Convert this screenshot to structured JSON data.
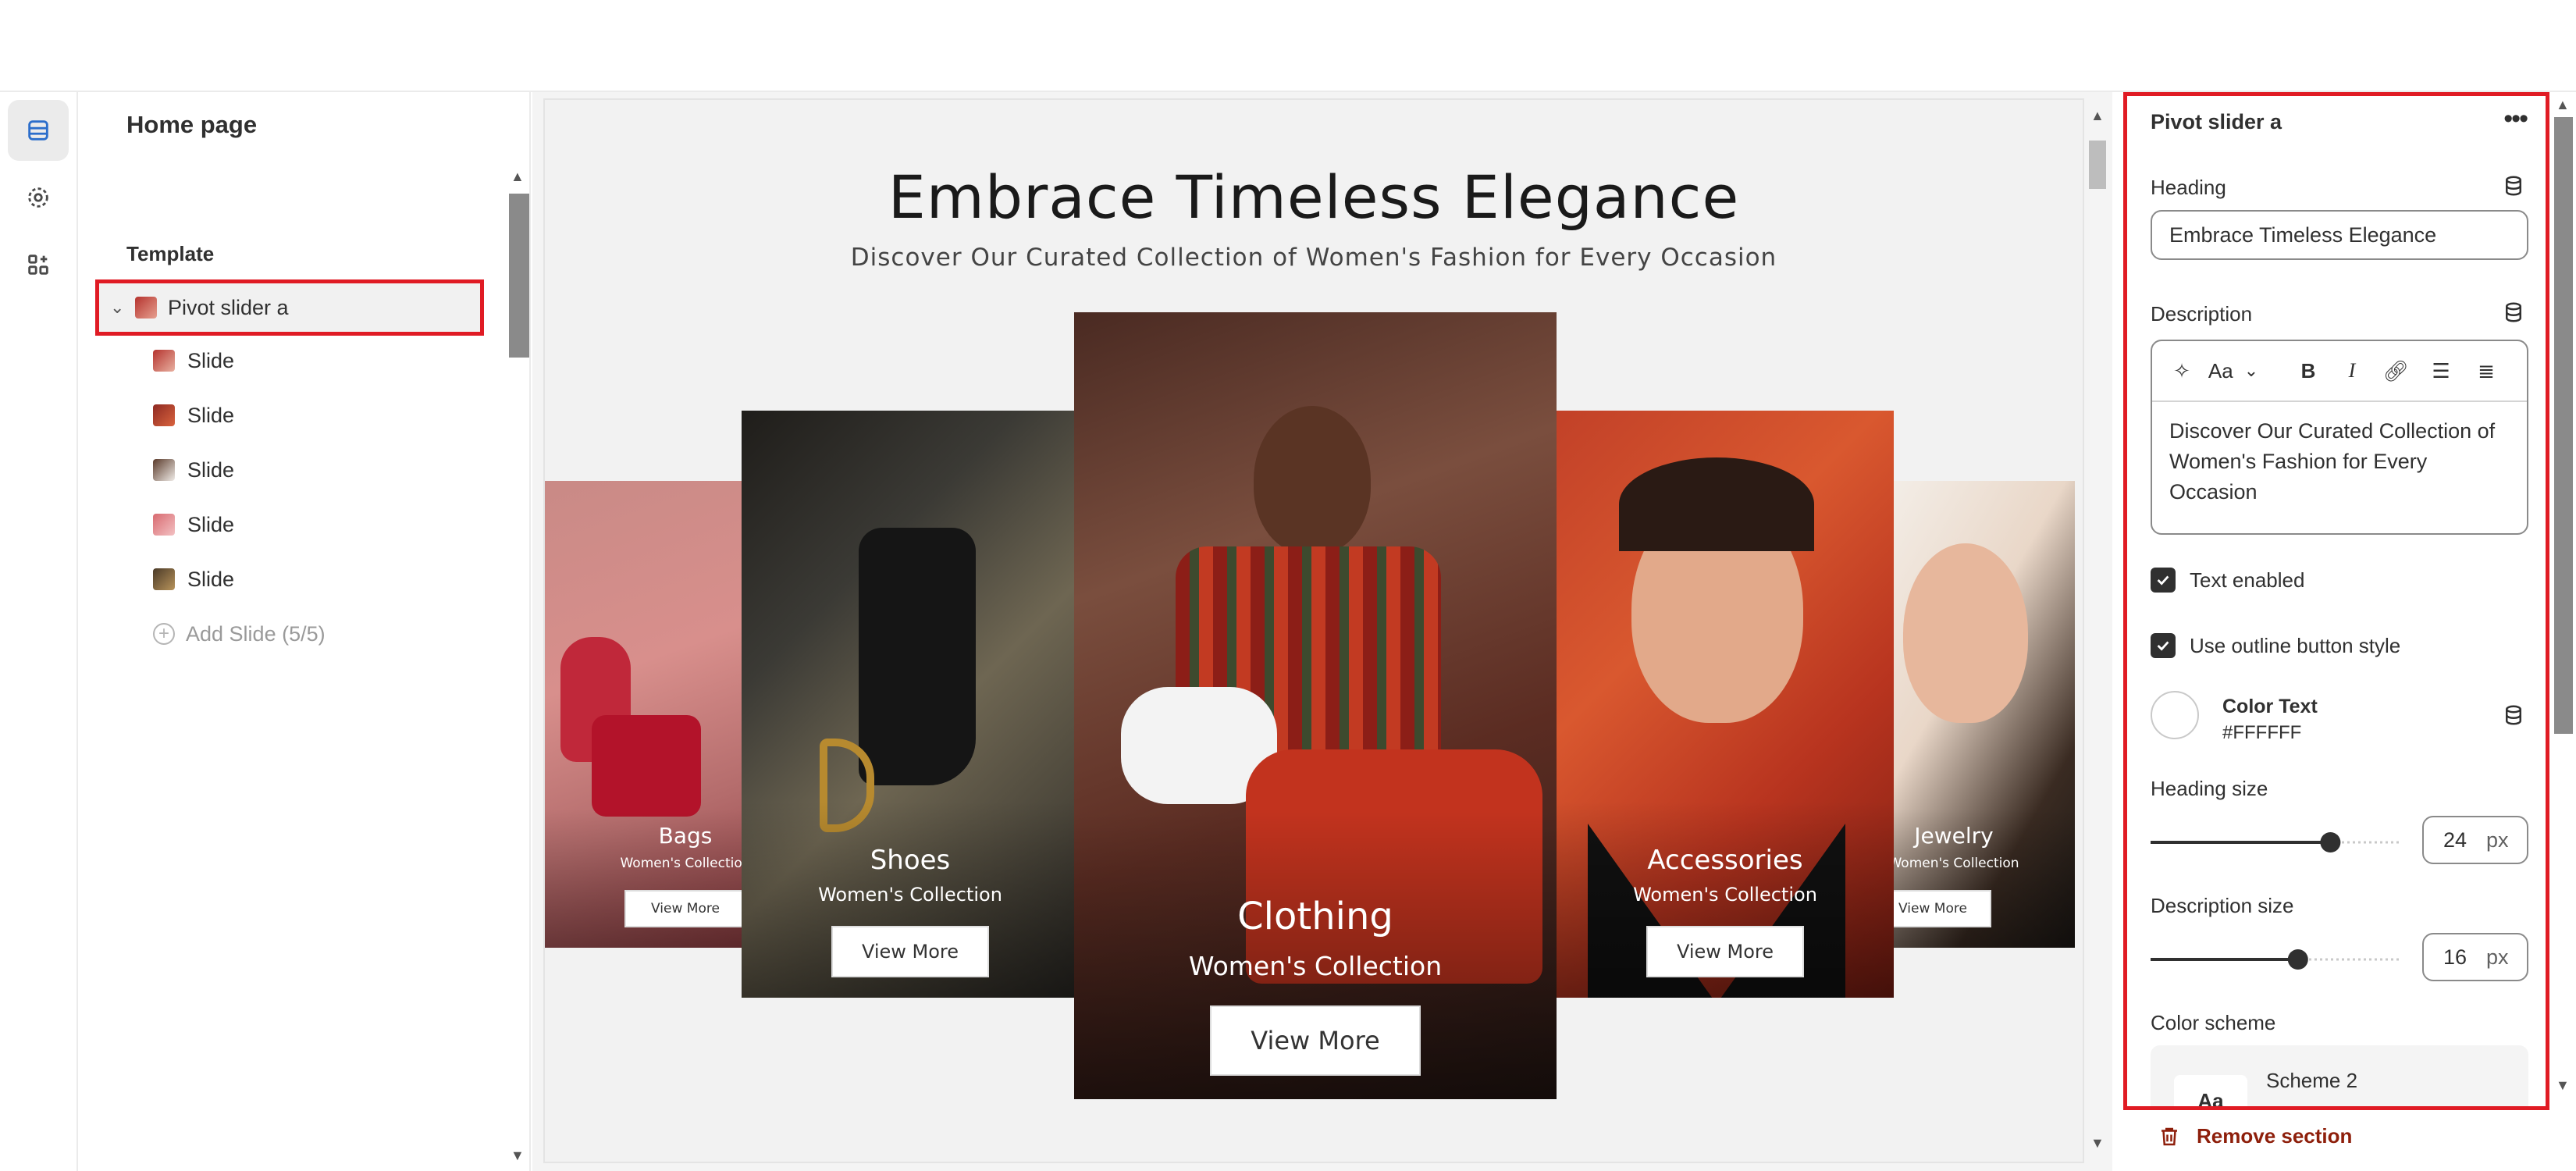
{
  "sidebar": {
    "title": "Home page",
    "group_label": "Template",
    "section": {
      "label": "Pivot slider a"
    },
    "items": [
      {
        "label": "Slide",
        "color": "#b5332e"
      },
      {
        "label": "Slide",
        "color": "#8e2a22"
      },
      {
        "label": "Slide",
        "color": "#5a3a2a"
      },
      {
        "label": "Slide",
        "color": "#d86a70"
      },
      {
        "label": "Slide",
        "color": "#4a3a28"
      }
    ],
    "add_label": "Add Slide (5/5)"
  },
  "preview": {
    "heading": "Embrace Timeless Elegance",
    "description": "Discover Our Curated Collection of Women's Fashion for Every Occasion",
    "slides": [
      {
        "title": "Bags",
        "subtitle": "Women's Collection",
        "button": "View More"
      },
      {
        "title": "Shoes",
        "subtitle": "Women's Collection",
        "button": "View More"
      },
      {
        "title": "Clothing",
        "subtitle": "Women's Collection",
        "button": "View More"
      },
      {
        "title": "Accessories",
        "subtitle": "Women's Collection",
        "button": "View More"
      },
      {
        "title": "Jewelry",
        "subtitle": "Women's Collection",
        "button": "View More"
      }
    ]
  },
  "panel": {
    "title": "Pivot slider a",
    "heading_label": "Heading",
    "heading_value": "Embrace Timeless Elegance",
    "description_label": "Description",
    "description_value": "Discover Our Curated Collection of Women's Fashion for Every Occasion",
    "text_enabled_label": "Text enabled",
    "text_enabled": true,
    "outline_label": "Use outline button style",
    "outline_enabled": true,
    "color_text_label": "Color Text",
    "color_text_value": "#FFFFFF",
    "heading_size_label": "Heading size",
    "heading_size_value": "24",
    "heading_size_fraction": 0.72,
    "description_size_label": "Description size",
    "description_size_value": "16",
    "description_size_fraction": 0.59,
    "unit": "px",
    "color_scheme_label": "Color scheme",
    "scheme_preview": "Aa",
    "scheme_name": "Scheme 2",
    "toolbar_font": "Aa"
  },
  "remove_label": "Remove section",
  "colors": {
    "highlight": "#e01b24",
    "remove": "#8e1f0b",
    "text": "#303030"
  }
}
